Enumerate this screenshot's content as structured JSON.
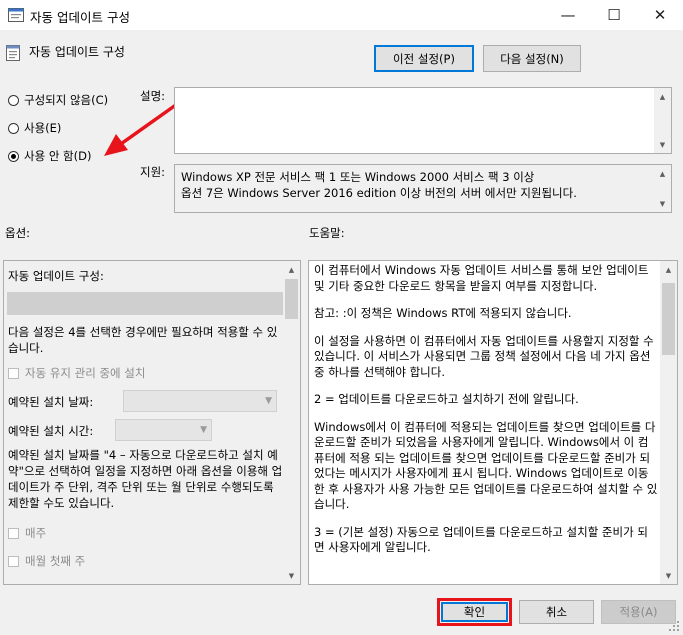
{
  "window": {
    "title": "자동 업데이트 구성",
    "minimize": "—",
    "maximize": "☐",
    "close": "✕"
  },
  "header": {
    "title": "자동 업데이트 구성"
  },
  "nav": {
    "prev": "이전 설정(P)",
    "next": "다음 설정(N)"
  },
  "radios": [
    {
      "label": "구성되지 않음(C)",
      "checked": false
    },
    {
      "label": "사용(E)",
      "checked": false
    },
    {
      "label": "사용 안 함(D)",
      "checked": true
    }
  ],
  "labels": {
    "comment": "설명:",
    "supported": "지원:",
    "options": "옵션:",
    "help": "도움말:"
  },
  "supported_text": [
    "Windows XP 전문 서비스 팩 1 또는 Windows 2000 서비스 팩 3 이상",
    "옵션 7은 Windows Server 2016 edition 이상 버전의 서버 에서만 지원됩니다."
  ],
  "options": {
    "configure_label": "자동 업데이트 구성:",
    "note": "다음 설정은 4를 선택한 경우에만 필요하며 적용할 수 있습니다.",
    "maintenance": "자동 유지 관리 중에 설치",
    "scheduled_day": "예약된 설치 날짜:",
    "scheduled_time": "예약된 설치 시간:",
    "desc": "예약된 설치 날짜를 \"4 – 자동으로 다운로드하고 설치 예약\"으로 선택하여 일정을 지정하면 아래 옵션을 이용해 업데이트가 주 단위, 격주 단위 또는 월 단위로 수행되도록 제한할 수도 있습니다.",
    "every_week": "매주",
    "first_week": "매월 첫째 주"
  },
  "help_paragraphs": [
    "이 컴퓨터에서 Windows 자동 업데이트 서비스를 통해 보안 업데이트 및 기타 중요한 다운로드 항목을 받을지 여부를 지정합니다.",
    "참고: :이 정책은 Windows RT에 적용되지 않습니다.",
    "이 설정을 사용하면 이 컴퓨터에서 자동 업데이트를 사용할지 지정할 수 있습니다. 이 서비스가 사용되면 그룹 정책 설정에서 다음 네 가지 옵션 중 하나를 선택해야 합니다.",
    " 2 = 업데이트를 다운로드하고 설치하기 전에 알립니다.",
    " Windows에서 이 컴퓨터에 적용되는 업데이트를 찾으면 업데이트를 다운로드할 준비가 되었음을 사용자에게 알립니다. Windows에서 이 컴퓨터에 적용 되는 업데이트를 찾으면 업데이트를 다운로드할 준비가 되었다는 메시지가 사용자에게 표시 됩니다. Windows 업데이트로 이동한 후 사용자가 사용 가능한 모든 업데이트를 다운로드하여 설치할 수 있습니다.",
    " 3 = (기본 설정) 자동으로 업데이트를 다운로드하고 설치할 준비가 되면 사용자에게 알립니다."
  ],
  "footer": {
    "ok": "확인",
    "cancel": "취소",
    "apply": "적용(A)"
  },
  "colors": {
    "annotation_red": "#e8141b",
    "focus_blue": "#0078d7"
  }
}
